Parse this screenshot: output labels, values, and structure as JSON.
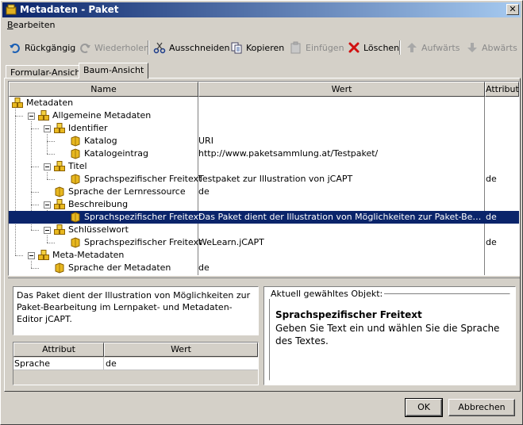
{
  "window": {
    "title": "Metadaten - Paket",
    "close_glyph": "✕"
  },
  "menu": {
    "bearbeiten_first": "B",
    "bearbeiten_rest": "earbeiten"
  },
  "toolbar": {
    "undo": "Rückgängig",
    "redo": "Wiederholen",
    "cut": "Ausschneiden",
    "copy": "Kopieren",
    "paste": "Einfügen",
    "delete": "Löschen",
    "up": "Aufwärts",
    "down": "Abwärts"
  },
  "tabs": {
    "form": "Formular-Ansicht",
    "tree": "Baum-Ansicht"
  },
  "tree": {
    "headers": {
      "name": "Name",
      "wert": "Wert",
      "attribut": "Attribut"
    },
    "rows": [
      {
        "name": "Metadaten",
        "wert": "",
        "attr": ""
      },
      {
        "name": "Allgemeine Metadaten",
        "wert": "",
        "attr": ""
      },
      {
        "name": "Identifier",
        "wert": "",
        "attr": ""
      },
      {
        "name": "Katalog",
        "wert": "URI",
        "attr": ""
      },
      {
        "name": "Katalogeintrag",
        "wert": "http://www.paketsammlung.at/Testpaket/",
        "attr": ""
      },
      {
        "name": "Titel",
        "wert": "",
        "attr": ""
      },
      {
        "name": "Sprachspezifischer Freitext",
        "wert": "Testpaket zur Illustration von jCAPT",
        "attr": "de"
      },
      {
        "name": "Sprache der Lernressource",
        "wert": "de",
        "attr": ""
      },
      {
        "name": "Beschreibung",
        "wert": "",
        "attr": ""
      },
      {
        "name": "Sprachspezifischer Freitext",
        "wert": "Das Paket dient der Illustration von Möglichkeiten zur Paket-Bearbeitung...",
        "attr": "de"
      },
      {
        "name": "Schlüsselwort",
        "wert": "",
        "attr": ""
      },
      {
        "name": "Sprachspezifischer Freitext",
        "wert": "WeLearn.jCAPT",
        "attr": "de"
      },
      {
        "name": "Meta-Metadaten",
        "wert": "",
        "attr": ""
      },
      {
        "name": "Sprache der Metadaten",
        "wert": "de",
        "attr": ""
      }
    ]
  },
  "description": "Das Paket dient der Illustration von Möglichkeiten zur Paket-Bearbeitung im Lernpaket- und Metadaten-Editor jCAPT.",
  "attr_table": {
    "headers": {
      "attribut": "Attribut",
      "wert": "Wert"
    },
    "row": {
      "attribut": "Sprache",
      "wert": "de"
    }
  },
  "selection": {
    "legend": "Aktuell gewähltes Objekt:",
    "title": "Sprachspezifischer Freitext",
    "description": "Geben Sie Text ein und wählen Sie die Sprache des Textes."
  },
  "buttons": {
    "ok": "OK",
    "cancel": "Abbrechen"
  },
  "colors": {
    "selection": "#0a246a",
    "face": "#d4d0c8",
    "title_gradient_end": "#a6caf0"
  }
}
